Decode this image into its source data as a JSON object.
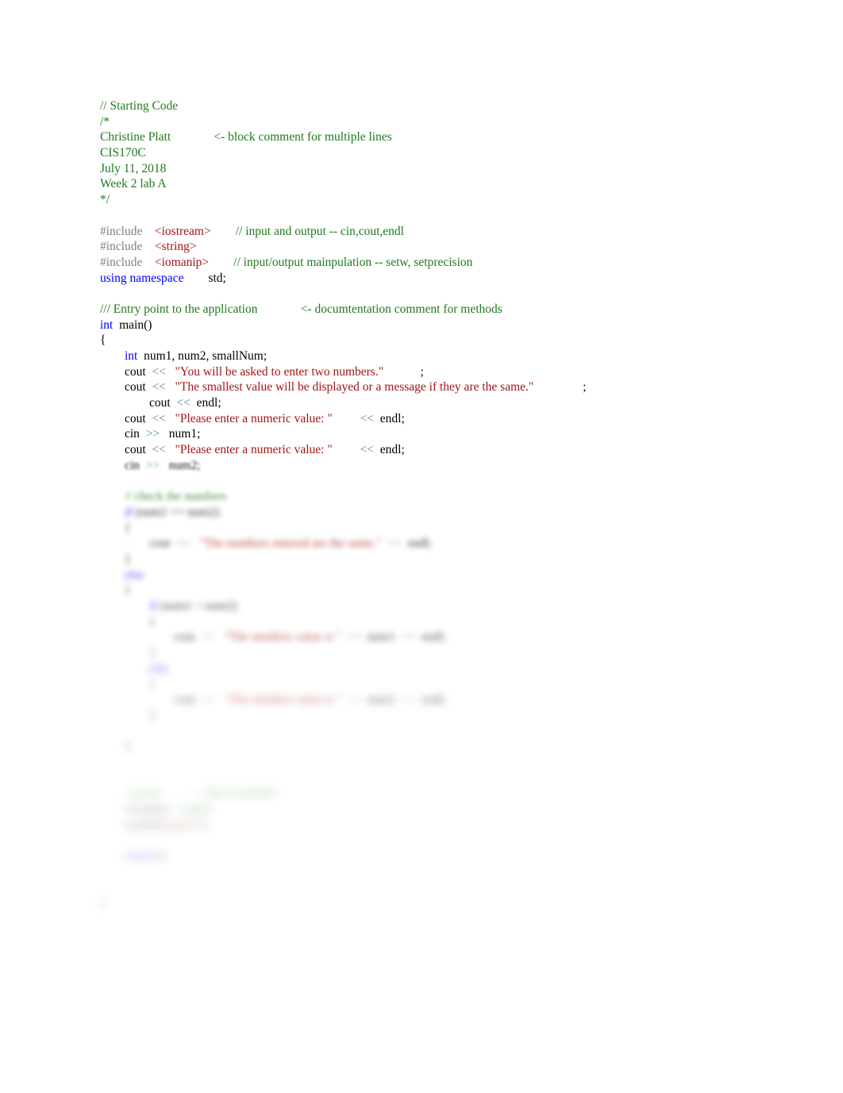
{
  "document": {
    "kind": "cpp-source-listing",
    "page_background": "#ffffff",
    "colors": {
      "comment": "#1F7A1F",
      "preprocessor": "#808080",
      "header_name": "#A31515",
      "keyword": "#0000FF",
      "string": "#A31515",
      "stream_operator": "#4F8A8B",
      "plain_text": "#000000"
    }
  },
  "code": {
    "lines": [
      {
        "id": "l01",
        "blur": 0,
        "tokens": [
          {
            "t": "// Starting Code",
            "c": "comment"
          }
        ]
      },
      {
        "id": "l02",
        "blur": 0,
        "tokens": [
          {
            "t": "/*",
            "c": "comment"
          }
        ]
      },
      {
        "id": "l03",
        "blur": 0,
        "tokens": [
          {
            "t": "Christine Platt",
            "c": "comment"
          },
          {
            "t": "              ",
            "c": "comment"
          },
          {
            "t": "<- block comment for multiple lines",
            "c": "comment"
          }
        ]
      },
      {
        "id": "l04",
        "blur": 0,
        "tokens": [
          {
            "t": "CIS170C",
            "c": "comment"
          }
        ]
      },
      {
        "id": "l05",
        "blur": 0,
        "tokens": [
          {
            "t": "July 11, 2018",
            "c": "comment"
          }
        ]
      },
      {
        "id": "l06",
        "blur": 0,
        "tokens": [
          {
            "t": "Week 2 lab A",
            "c": "comment"
          }
        ]
      },
      {
        "id": "l07",
        "blur": 0,
        "tokens": [
          {
            "t": "*/",
            "c": "comment"
          }
        ]
      },
      {
        "id": "l08",
        "blur": 0,
        "tokens": []
      },
      {
        "id": "l09",
        "blur": 0,
        "tokens": [
          {
            "t": "#include",
            "c": "preprocessor"
          },
          {
            "t": "    ",
            "c": "plain"
          },
          {
            "t": "<iostream>",
            "c": "header_name"
          },
          {
            "t": "        ",
            "c": "plain"
          },
          {
            "t": "// input and output -- cin,cout,endl",
            "c": "comment"
          }
        ]
      },
      {
        "id": "l10",
        "blur": 0,
        "tokens": [
          {
            "t": "#include",
            "c": "preprocessor"
          },
          {
            "t": "    ",
            "c": "plain"
          },
          {
            "t": "<string>",
            "c": "header_name"
          }
        ]
      },
      {
        "id": "l11",
        "blur": 0,
        "tokens": [
          {
            "t": "#include",
            "c": "preprocessor"
          },
          {
            "t": "    ",
            "c": "plain"
          },
          {
            "t": "<iomanip>",
            "c": "header_name"
          },
          {
            "t": "        ",
            "c": "plain"
          },
          {
            "t": "// input/output mainpulation -- setw, setprecision",
            "c": "comment"
          }
        ]
      },
      {
        "id": "l12",
        "blur": 0,
        "tokens": [
          {
            "t": "using namespace",
            "c": "keyword"
          },
          {
            "t": "        ",
            "c": "plain"
          },
          {
            "t": "std;",
            "c": "plain"
          }
        ]
      },
      {
        "id": "l13",
        "blur": 0,
        "tokens": []
      },
      {
        "id": "l14",
        "blur": 0,
        "tokens": [
          {
            "t": "/// Entry point to the application",
            "c": "comment"
          },
          {
            "t": "              ",
            "c": "comment"
          },
          {
            "t": "<- documtentation comment for methods",
            "c": "comment"
          }
        ]
      },
      {
        "id": "l15",
        "blur": 0,
        "tokens": [
          {
            "t": "int",
            "c": "keyword"
          },
          {
            "t": "  main()",
            "c": "plain"
          }
        ]
      },
      {
        "id": "l16",
        "blur": 0,
        "tokens": [
          {
            "t": "{",
            "c": "plain"
          }
        ]
      },
      {
        "id": "l17",
        "blur": 0,
        "tokens": [
          {
            "t": "        ",
            "c": "plain"
          },
          {
            "t": "int",
            "c": "keyword"
          },
          {
            "t": "  num1, num2, smallNum;",
            "c": "plain"
          }
        ]
      },
      {
        "id": "l18",
        "blur": 0,
        "tokens": [
          {
            "t": "        cout  ",
            "c": "plain"
          },
          {
            "t": "<<",
            "c": "stream_operator"
          },
          {
            "t": "   ",
            "c": "plain"
          },
          {
            "t": "\"You will be asked to enter two numbers.\"",
            "c": "string"
          },
          {
            "t": "            ",
            "c": "plain"
          },
          {
            "t": ";",
            "c": "plain"
          }
        ]
      },
      {
        "id": "l19",
        "blur": 0,
        "tokens": [
          {
            "t": "        cout  ",
            "c": "plain"
          },
          {
            "t": "<<",
            "c": "stream_operator"
          },
          {
            "t": "   ",
            "c": "plain"
          },
          {
            "t": "\"The smallest value will be displayed or a message if they are the same.\"",
            "c": "string"
          },
          {
            "t": "                ",
            "c": "plain"
          },
          {
            "t": ";",
            "c": "plain"
          }
        ]
      },
      {
        "id": "l20",
        "blur": 0,
        "tokens": [
          {
            "t": "                cout  ",
            "c": "plain"
          },
          {
            "t": "<<",
            "c": "stream_operator"
          },
          {
            "t": "  endl;",
            "c": "plain"
          }
        ]
      },
      {
        "id": "l21",
        "blur": 0,
        "tokens": [
          {
            "t": "        cout  ",
            "c": "plain"
          },
          {
            "t": "<<",
            "c": "stream_operator"
          },
          {
            "t": "   ",
            "c": "plain"
          },
          {
            "t": "\"Please enter a numeric value: \"",
            "c": "string"
          },
          {
            "t": "         ",
            "c": "plain"
          },
          {
            "t": "<<",
            "c": "stream_operator"
          },
          {
            "t": "  endl;",
            "c": "plain"
          }
        ]
      },
      {
        "id": "l22",
        "blur": 0,
        "tokens": [
          {
            "t": "        cin  ",
            "c": "plain"
          },
          {
            "t": ">>",
            "c": "stream_operator"
          },
          {
            "t": "   num1;",
            "c": "plain"
          }
        ]
      },
      {
        "id": "l23",
        "blur": 0,
        "tokens": [
          {
            "t": "        cout  ",
            "c": "plain"
          },
          {
            "t": "<<",
            "c": "stream_operator"
          },
          {
            "t": "   ",
            "c": "plain"
          },
          {
            "t": "\"Please enter a numeric value: \"",
            "c": "string"
          },
          {
            "t": "         ",
            "c": "plain"
          },
          {
            "t": "<<",
            "c": "stream_operator"
          },
          {
            "t": "  endl;",
            "c": "plain"
          }
        ]
      },
      {
        "id": "l24",
        "blur": 1,
        "tokens": [
          {
            "t": "        cin  ",
            "c": "plain"
          },
          {
            "t": ">>",
            "c": "stream_operator"
          },
          {
            "t": "   num2;",
            "c": "plain"
          }
        ]
      },
      {
        "id": "l25",
        "blur": 2,
        "tokens": []
      },
      {
        "id": "l26",
        "blur": 2,
        "tokens": [
          {
            "t": "        ",
            "c": "plain"
          },
          {
            "t": "// check the numbers",
            "c": "comment"
          }
        ]
      },
      {
        "id": "l27",
        "blur": 3,
        "tokens": [
          {
            "t": "        ",
            "c": "plain"
          },
          {
            "t": "if",
            "c": "keyword"
          },
          {
            "t": " (num1 == num2)",
            "c": "plain"
          }
        ]
      },
      {
        "id": "l28",
        "blur": 3,
        "tokens": [
          {
            "t": "        {",
            "c": "plain"
          }
        ]
      },
      {
        "id": "l29",
        "blur": 3,
        "tokens": [
          {
            "t": "                cout  ",
            "c": "plain"
          },
          {
            "t": "<<",
            "c": "stream_operator"
          },
          {
            "t": "   ",
            "c": "plain"
          },
          {
            "t": "\"The numbers entered are the same.\"",
            "c": "string"
          },
          {
            "t": "  ",
            "c": "plain"
          },
          {
            "t": "<<",
            "c": "stream_operator"
          },
          {
            "t": "  endl;",
            "c": "plain"
          }
        ]
      },
      {
        "id": "l30",
        "blur": 3,
        "tokens": [
          {
            "t": "        }",
            "c": "plain"
          }
        ]
      },
      {
        "id": "l31",
        "blur": 4,
        "tokens": [
          {
            "t": "        ",
            "c": "plain"
          },
          {
            "t": "else",
            "c": "keyword"
          }
        ]
      },
      {
        "id": "l32",
        "blur": 4,
        "tokens": [
          {
            "t": "        {",
            "c": "plain"
          }
        ]
      },
      {
        "id": "l33",
        "blur": 4,
        "tokens": [
          {
            "t": "                ",
            "c": "plain"
          },
          {
            "t": "if",
            "c": "keyword"
          },
          {
            "t": " (num1 < num2)",
            "c": "plain"
          }
        ]
      },
      {
        "id": "l34",
        "blur": 4,
        "tokens": [
          {
            "t": "                {",
            "c": "plain"
          }
        ]
      },
      {
        "id": "l35",
        "blur": 4,
        "tokens": [
          {
            "t": "                        cout  ",
            "c": "plain"
          },
          {
            "t": "<<",
            "c": "stream_operator"
          },
          {
            "t": "   ",
            "c": "plain"
          },
          {
            "t": "\"The smallest value is \"",
            "c": "string"
          },
          {
            "t": "  ",
            "c": "plain"
          },
          {
            "t": "<<",
            "c": "stream_operator"
          },
          {
            "t": "  num1  ",
            "c": "plain"
          },
          {
            "t": "<<",
            "c": "stream_operator"
          },
          {
            "t": "  endl;",
            "c": "plain"
          }
        ]
      },
      {
        "id": "l36",
        "blur": 5,
        "tokens": [
          {
            "t": "                }",
            "c": "plain"
          }
        ]
      },
      {
        "id": "l37",
        "blur": 5,
        "tokens": [
          {
            "t": "                ",
            "c": "plain"
          },
          {
            "t": "else",
            "c": "keyword"
          }
        ]
      },
      {
        "id": "l38",
        "blur": 5,
        "tokens": [
          {
            "t": "                {",
            "c": "plain"
          }
        ]
      },
      {
        "id": "l39",
        "blur": 5,
        "tokens": [
          {
            "t": "                        cout  ",
            "c": "plain"
          },
          {
            "t": "<<",
            "c": "stream_operator"
          },
          {
            "t": "   ",
            "c": "plain"
          },
          {
            "t": "\"The smallest value is \"",
            "c": "string"
          },
          {
            "t": "  ",
            "c": "plain"
          },
          {
            "t": "<<",
            "c": "stream_operator"
          },
          {
            "t": "  num2  ",
            "c": "plain"
          },
          {
            "t": "<<",
            "c": "stream_operator"
          },
          {
            "t": "  endl;",
            "c": "plain"
          }
        ]
      },
      {
        "id": "l40",
        "blur": 5,
        "tokens": [
          {
            "t": "                }",
            "c": "plain"
          }
        ]
      },
      {
        "id": "l41",
        "blur": 5,
        "tokens": []
      },
      {
        "id": "l42",
        "blur": 5,
        "tokens": [
          {
            "t": "        }",
            "c": "plain"
          }
        ]
      },
      {
        "id": "l43",
        "blur": 6,
        "tokens": []
      },
      {
        "id": "l44",
        "blur": 6,
        "tokens": []
      },
      {
        "id": "l45",
        "blur": 6,
        "tokens": [
          {
            "t": "        ",
            "c": "plain"
          },
          {
            "t": "// pause",
            "c": "comment"
          },
          {
            "t": "          ",
            "c": "plain"
          },
          {
            "t": "<- this is needed",
            "c": "comment"
          }
        ]
      },
      {
        "id": "l46",
        "blur": 6,
        "tokens": [
          {
            "t": "        cin.",
            "c": "plain"
          },
          {
            "t": "get",
            "c": "plain"
          },
          {
            "t": "();  ",
            "c": "plain"
          },
          {
            "t": "// pause",
            "c": "comment"
          }
        ]
      },
      {
        "id": "l47",
        "blur": 6,
        "tokens": [
          {
            "t": "        system(",
            "c": "plain"
          },
          {
            "t": "\"pause\"",
            "c": "string"
          },
          {
            "t": ");",
            "c": "plain"
          }
        ]
      },
      {
        "id": "l48",
        "blur": 6,
        "tokens": []
      },
      {
        "id": "l49",
        "blur": 6,
        "tokens": [
          {
            "t": "        ",
            "c": "plain"
          },
          {
            "t": "return",
            "c": "keyword"
          },
          {
            "t": " 0;",
            "c": "plain"
          }
        ]
      },
      {
        "id": "l50",
        "blur": 6,
        "tokens": []
      },
      {
        "id": "l51",
        "blur": 6,
        "tokens": []
      },
      {
        "id": "l52",
        "blur": 6,
        "tokens": [
          {
            "t": "}",
            "c": "plain"
          }
        ]
      }
    ]
  }
}
